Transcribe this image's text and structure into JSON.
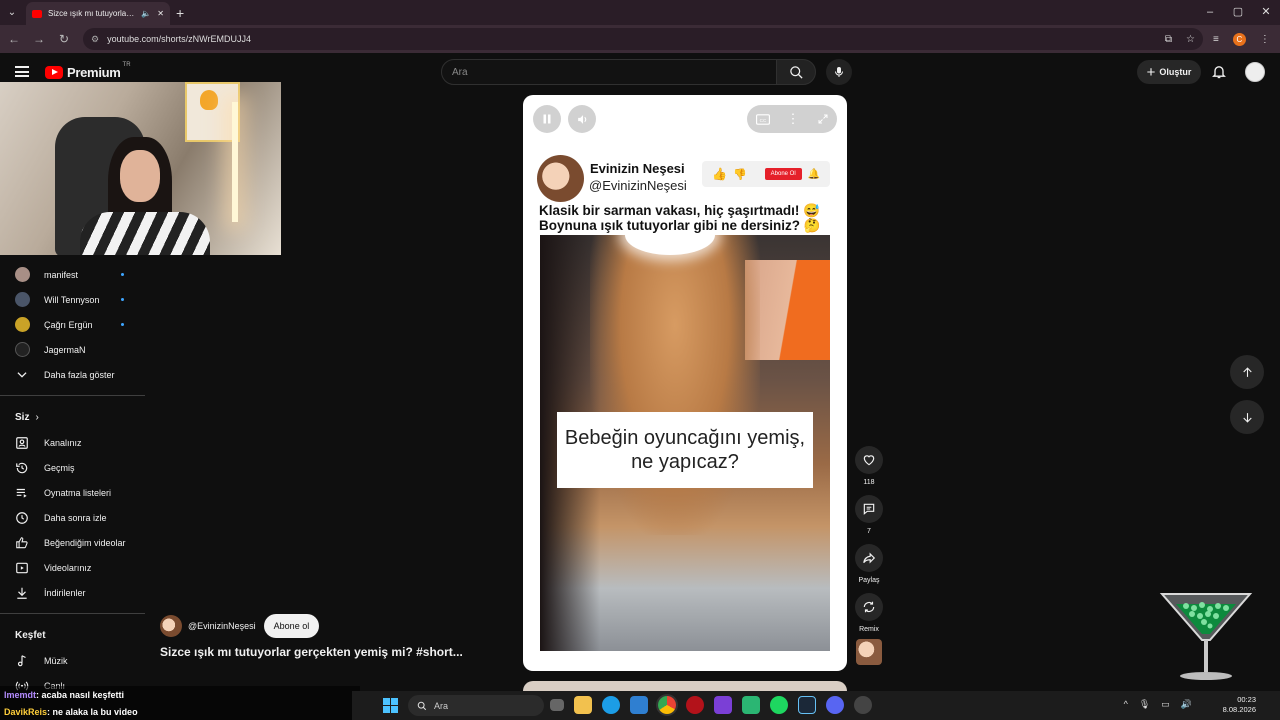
{
  "browser": {
    "tab_title": "Sizce ışık mı tutuyorlar gerç...",
    "url": "youtube.com/shorts/zNWrEMDUJJ4"
  },
  "header": {
    "logo_text": "Premium",
    "logo_badge": "TR",
    "search_placeholder": "Ara",
    "create_label": "Oluştur"
  },
  "sidebar": {
    "subscriptions": [
      {
        "label": "manifest",
        "color": "#a88f86",
        "new": true
      },
      {
        "label": "Will Tennyson",
        "color": "#4a5568",
        "new": true
      },
      {
        "label": "Çağrı Ergün",
        "color": "#c9a227",
        "new": true
      },
      {
        "label": "JagermaN",
        "color": "#222222",
        "new": false
      }
    ],
    "show_more": "Daha fazla göster",
    "you_heading": "Siz",
    "you_items": [
      {
        "label": "Kanalınız",
        "icon": "channel-icon"
      },
      {
        "label": "Geçmiş",
        "icon": "history-icon"
      },
      {
        "label": "Oynatma listeleri",
        "icon": "playlists-icon"
      },
      {
        "label": "Daha sonra izle",
        "icon": "watch-later-icon"
      },
      {
        "label": "Beğendiğim videolar",
        "icon": "liked-icon"
      },
      {
        "label": "Videolarınız",
        "icon": "your-videos-icon"
      },
      {
        "label": "İndirilenler",
        "icon": "downloads-icon"
      }
    ],
    "explore_heading": "Keşfet",
    "explore_items": [
      {
        "label": "Müzik",
        "icon": "music-icon"
      },
      {
        "label": "Canlı",
        "icon": "live-icon"
      }
    ]
  },
  "short": {
    "channel_name": "Evinizin Neşesi",
    "channel_handle": "@EvinizinNeşesi",
    "subscribe_small": "Abone Ol",
    "caption_line1": "Klasik bir sarman vakası, hiç şaşırtmadı! 😅",
    "caption_line2": "Boynuna ışık tutuyorlar gibi ne dersiniz? 🤔",
    "video_text": "Bebeğin oyuncağını yemiş, ne yapıcaz?",
    "likes": "118",
    "comments": "7",
    "share_label": "Paylaş",
    "remix_label": "Remix"
  },
  "info": {
    "handle": "@EvinizinNeşesi",
    "subscribe_label": "Abone ol",
    "title": "Sizce ışık mı tutuyorlar gerçekten yemiş mi? #short..."
  },
  "chat": [
    {
      "user": "lmemdt",
      "message": " : acaba nasıl keşfetti"
    },
    {
      "user": "DavikReis",
      "message": " : ne alaka la bu video"
    }
  ],
  "taskbar": {
    "search_placeholder": "Ara",
    "time": "00:23",
    "date": "8.08.2026"
  },
  "colors": {
    "brand_red": "#ff0000",
    "accent_blue": "#3ea6ff"
  }
}
